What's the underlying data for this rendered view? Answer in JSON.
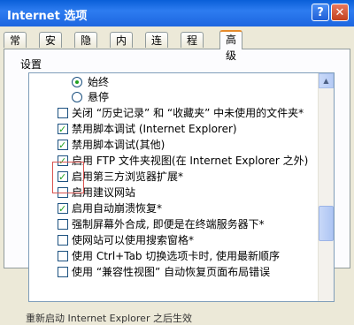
{
  "window": {
    "title": "Internet 选项",
    "help_label": "?",
    "close_label": "✕"
  },
  "tabs": [
    "常规",
    "安全",
    "隐私",
    "内容",
    "连接",
    "程序",
    "高级"
  ],
  "section_label": "设置",
  "options": [
    {
      "type": "radio",
      "checked": true,
      "label": "始终"
    },
    {
      "type": "radio",
      "checked": false,
      "label": "悬停"
    },
    {
      "type": "checkbox",
      "checked": false,
      "label": "关闭 “历史记录” 和 “收藏夹” 中未使用的文件夹*"
    },
    {
      "type": "checkbox",
      "checked": true,
      "label": "禁用脚本调试 (Internet Explorer)"
    },
    {
      "type": "checkbox",
      "checked": true,
      "label": "禁用脚本调试(其他)"
    },
    {
      "type": "checkbox",
      "checked": true,
      "label": "启用 FTP 文件夹视图(在 Internet Explorer 之外)"
    },
    {
      "type": "checkbox",
      "checked": true,
      "label": "启用第三方浏览器扩展*"
    },
    {
      "type": "checkbox",
      "checked": false,
      "label": "启用建议网站"
    },
    {
      "type": "checkbox",
      "checked": true,
      "label": "启用自动崩溃恢复*"
    },
    {
      "type": "checkbox",
      "checked": false,
      "label": "强制屏幕外合成, 即便是在终端服务器下*"
    },
    {
      "type": "checkbox",
      "checked": false,
      "label": "使网站可以使用搜索窗格*"
    },
    {
      "type": "checkbox",
      "checked": false,
      "label": "使用 Ctrl+Tab 切换选项卡时, 使用最新顺序"
    },
    {
      "type": "checkbox",
      "checked": false,
      "label": "使用 “兼容性视图” 自动恢复页面布局错误"
    }
  ],
  "footer_partial": "重新启动 Internet Explorer 之后生效"
}
